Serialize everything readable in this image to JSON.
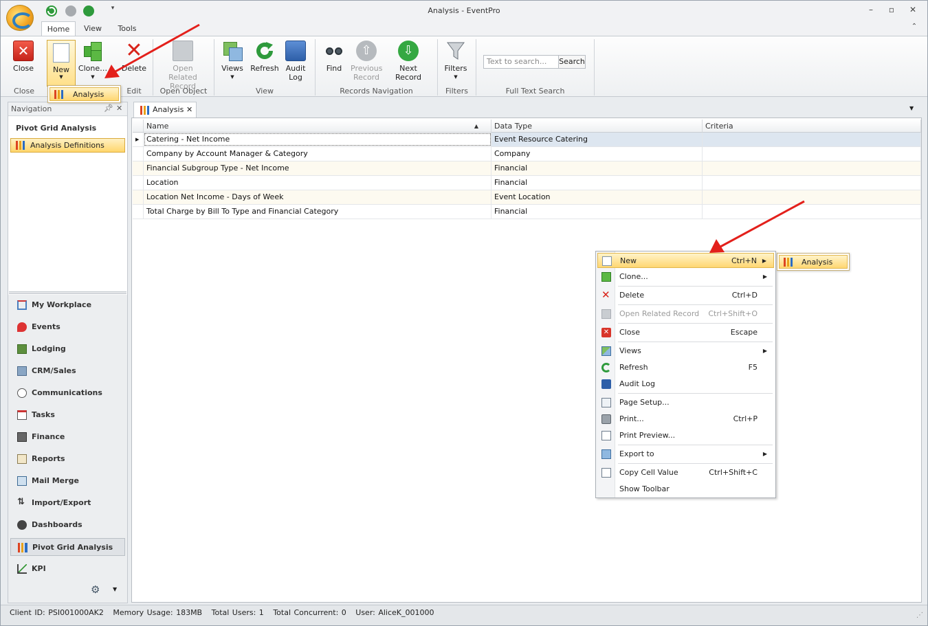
{
  "window": {
    "title": "Analysis - EventPro"
  },
  "ribbon_tabs": [
    "Home",
    "View",
    "Tools"
  ],
  "ribbon": {
    "close": "Close",
    "new": "New",
    "clone": "Clone…",
    "delete": "Delete",
    "open_related_record": "Open Related Record",
    "views": "Views",
    "refresh": "Refresh",
    "audit_log": "Audit Log",
    "find": "Find",
    "previous_record": "Previous Record",
    "next_record": "Next Record",
    "filters": "Filters",
    "search_placeholder": "Text to search...",
    "search_button": "Search",
    "groups": {
      "close": "Close",
      "edit": "Edit",
      "open_object": "Open Object",
      "view": "View",
      "records_navigation": "Records Navigation",
      "filters": "Filters",
      "full_text_search": "Full Text Search"
    }
  },
  "new_dropdown": {
    "item": "Analysis"
  },
  "navigation": {
    "header": "Navigation",
    "title": "Pivot Grid Analysis",
    "selected_item": "Analysis Definitions",
    "items": [
      "My Workplace",
      "Events",
      "Lodging",
      "CRM/Sales",
      "Communications",
      "Tasks",
      "Finance",
      "Reports",
      "Mail Merge",
      "Import/Export",
      "Dashboards",
      "Pivot Grid Analysis",
      "KPI"
    ],
    "active_item": "Pivot Grid Analysis"
  },
  "document_tab": {
    "label": "Analysis"
  },
  "grid": {
    "columns": [
      "Name",
      "Data Type",
      "Criteria"
    ],
    "rows": [
      [
        "Catering - Net Income",
        "Event Resource Catering",
        ""
      ],
      [
        "Company by Account Manager & Category",
        "Company",
        ""
      ],
      [
        "Financial Subgroup Type - Net Income",
        "Financial",
        ""
      ],
      [
        "Location",
        "Financial",
        ""
      ],
      [
        "Location Net Income - Days of Week",
        "Event Location",
        ""
      ],
      [
        "Total Charge by Bill To Type and Financial Category",
        "Financial",
        ""
      ]
    ]
  },
  "context_menu": {
    "items": [
      {
        "label": "New",
        "shortcut": "Ctrl+N"
      },
      {
        "label": "Clone...",
        "shortcut": ""
      },
      {
        "label": "Delete",
        "shortcut": "Ctrl+D"
      },
      {
        "label": "Open Related Record",
        "shortcut": "Ctrl+Shift+O"
      },
      {
        "label": "Close",
        "shortcut": "Escape"
      },
      {
        "label": "Views",
        "shortcut": ""
      },
      {
        "label": "Refresh",
        "shortcut": "F5"
      },
      {
        "label": "Audit Log",
        "shortcut": ""
      },
      {
        "label": "Page Setup...",
        "shortcut": ""
      },
      {
        "label": "Print...",
        "shortcut": "Ctrl+P"
      },
      {
        "label": "Print Preview...",
        "shortcut": ""
      },
      {
        "label": "Export to",
        "shortcut": ""
      },
      {
        "label": "Copy Cell Value",
        "shortcut": "Ctrl+Shift+C"
      },
      {
        "label": "Show Toolbar",
        "shortcut": ""
      }
    ],
    "submenu_item": "Analysis"
  },
  "status_bar": {
    "client_id": "Client ID: PSI001000AK2",
    "memory": "Memory Usage: 183MB",
    "total_users": "Total Users: 1",
    "total_concurrent": "Total Concurrent: 0",
    "user": "User: AliceK_001000"
  },
  "colors": {
    "highlight": "#ffd772",
    "annotation_arrow": "#e3201b"
  }
}
